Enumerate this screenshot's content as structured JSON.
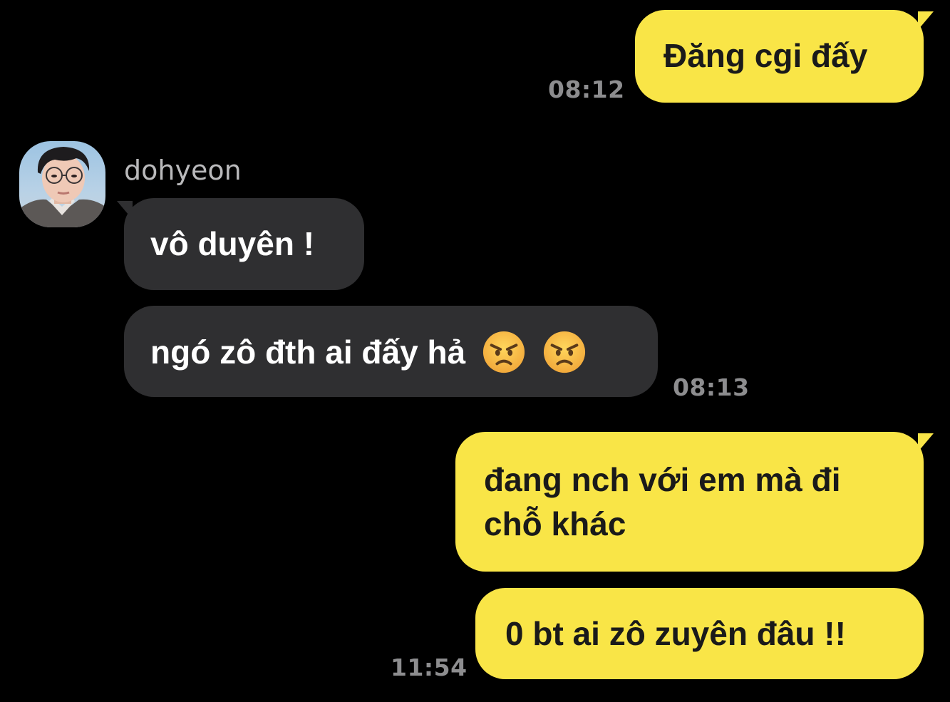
{
  "colors": {
    "background": "#000000",
    "outgoing_bubble": "#f9e547",
    "incoming_bubble": "#2f2f31",
    "timestamp": "#8d8d8f"
  },
  "messages": {
    "m1": {
      "text": "Đăng cgi đấy",
      "time": "08:12"
    },
    "contact": {
      "name": "dohyeon",
      "avatar_icon": "profile-photo"
    },
    "m2": {
      "text": "vô duyên !"
    },
    "m3": {
      "text": "ngó zô đth ai đấy hả",
      "emoji_icon": "angry-face-icon",
      "time": "08:13"
    },
    "m4": {
      "line1": "đang nch với em mà đi",
      "line2": "chỗ khác"
    },
    "m5": {
      "text": "0 bt ai zô zuyên đâu !!",
      "time": "11:54"
    }
  }
}
